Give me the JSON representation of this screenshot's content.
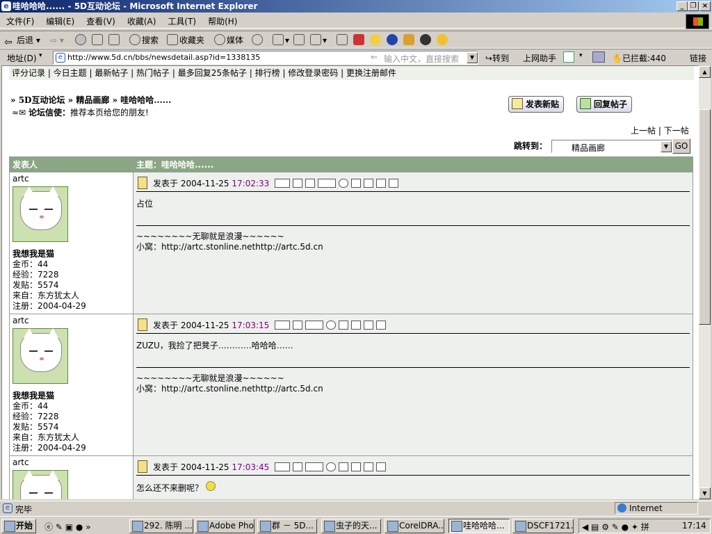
{
  "window": {
    "title": "哇哈哈哈...... - 5D互动论坛 - Microsoft Internet Explorer"
  },
  "menu": [
    "文件(F)",
    "编辑(E)",
    "查看(V)",
    "收藏(A)",
    "工具(T)",
    "帮助(H)"
  ],
  "toolbar": {
    "back": "后退",
    "search": "搜索",
    "favorites": "收藏夹",
    "media": "媒体"
  },
  "address": {
    "label": "地址(D)",
    "url": "http://www.5d.cn/bbs/newsdetail.asp?id=1338135",
    "hint": "输入中文，直接搜索",
    "go": "转到",
    "assistant": "上网助手",
    "blocked": "已拦截:440",
    "links": "链接"
  },
  "topnav": "评分记录 | 今日主题 | 最新帖子 | 热门帖子 | 最多回复25条帖子 | 排行榜 | 修改登录密码 | 更换注册邮件",
  "breadcrumb": {
    "home": "5D互动论坛",
    "board": "精品画廊",
    "topic": "哇哈哈哈......"
  },
  "forum_mail": {
    "label": "论坛信使：",
    "text": "推荐本页给您的朋友!"
  },
  "buttons": {
    "new_post": "发表新贴",
    "reply": "回复帖子"
  },
  "pager": {
    "prev": "上一帖",
    "next": "下一帖"
  },
  "jump": {
    "label": "跳转到：",
    "selected": "精品画廊",
    "go": "GO"
  },
  "table": {
    "author_header": "发表人",
    "subject_header": "主题：哇哈哈哈......"
  },
  "posts": [
    {
      "author": "artc",
      "title": "我想我是猫",
      "coins": "金币：44",
      "exp": "经验：7228",
      "count": "发贴：5574",
      "from": "来自：东方犹太人",
      "reg": "注册：2004-04-29",
      "date": "发表于 2004-11-25",
      "time": "17:02:33",
      "body": "占位",
      "sig1": "~~~~~~~~无聊就是浪漫~~~~~~",
      "sig2": "小窝：http://artc.stonline.nethttp://artc.5d.cn"
    },
    {
      "author": "artc",
      "title": "我想我是猫",
      "coins": "金币：44",
      "exp": "经验：7228",
      "count": "发贴：5574",
      "from": "来自：东方犹太人",
      "reg": "注册：2004-04-29",
      "date": "发表于 2004-11-25",
      "time": "17:03:15",
      "body": "ZUZU，我捡了把凳子…………哈哈哈……",
      "sig1": "~~~~~~~~无聊就是浪漫~~~~~~",
      "sig2": "小窝：http://artc.stonline.nethttp://artc.5d.cn"
    },
    {
      "author": "artc",
      "date": "发表于 2004-11-25",
      "time": "17:03:45",
      "body": "怎么还不来删呢？"
    }
  ],
  "status": {
    "text": "完毕",
    "zone": "Internet"
  },
  "taskbar": {
    "start": "开始",
    "tasks": [
      "292. 陈明 ...",
      "Adobe Pho...",
      "群 － 5D...",
      "虫子的天...",
      "CorelDRA...",
      "哇哈哈哈...",
      "DSCF1721..."
    ],
    "clock": "17:14"
  }
}
